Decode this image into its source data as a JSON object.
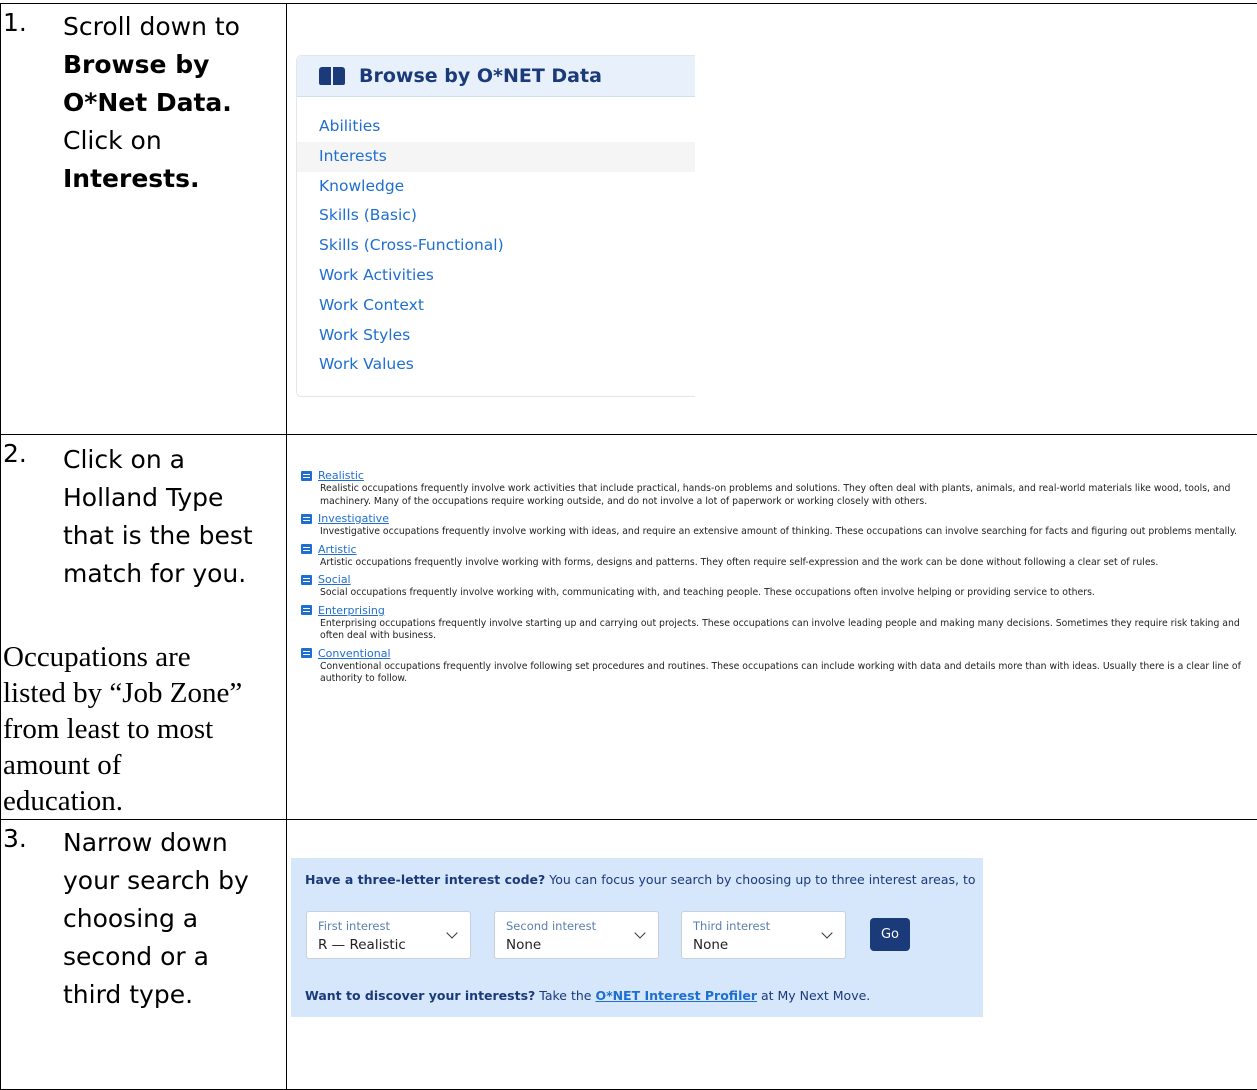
{
  "steps": [
    {
      "num": "1.",
      "line1": "Scroll down to",
      "bold1": "Browse by",
      "bold2": "O*Net Data.",
      "line2": "Click on",
      "bold3": "Interests."
    },
    {
      "num": "2.",
      "lines": [
        "Click on a",
        "Holland Type",
        "that is the best",
        "match for you."
      ]
    },
    {
      "num": "3.",
      "lines": [
        "Narrow down",
        "your search by",
        "choosing a",
        "second or a",
        "third type."
      ]
    }
  ],
  "note": [
    "Occupations are",
    "listed by “Job Zone”",
    "from least to most",
    "amount of",
    "education."
  ],
  "browse": {
    "title": "Browse by O*NET Data",
    "items": [
      "Abilities",
      "Interests",
      "Knowledge",
      "Skills (Basic)",
      "Skills (Cross-Functional)",
      "Work Activities",
      "Work Context",
      "Work Styles",
      "Work Values"
    ]
  },
  "types": [
    {
      "name": "Realistic",
      "desc": "Realistic occupations frequently involve work activities that include practical, hands-on problems and solutions. They often deal with plants, animals, and real-world materials like wood, tools, and machinery. Many of the occupations require working outside, and do not involve a lot of paperwork or working closely with others."
    },
    {
      "name": "Investigative",
      "desc": "Investigative occupations frequently involve working with ideas, and require an extensive amount of thinking. These occupations can involve searching for facts and figuring out problems mentally."
    },
    {
      "name": "Artistic",
      "desc": "Artistic occupations frequently involve working with forms, designs and patterns. They often require self-expression and the work can be done without following a clear set of rules."
    },
    {
      "name": "Social",
      "desc": "Social occupations frequently involve working with, communicating with, and teaching people. These occupations often involve helping or providing service to others."
    },
    {
      "name": "Enterprising",
      "desc": "Enterprising occupations frequently involve starting up and carrying out projects. These occupations can involve leading people and making many decisions. Sometimes they require risk taking and often deal with business."
    },
    {
      "name": "Conventional",
      "desc": "Conventional occupations frequently involve following set procedures and routines. These occupations can include working with data and details more than with ideas. Usually there is a clear line of authority to follow."
    }
  ],
  "interest": {
    "head_bold": "Have a three-letter interest code?",
    "head_rest": " You can focus your search by choosing up to three interest areas, to",
    "selects": [
      {
        "label": "First interest",
        "value": "R — Realistic"
      },
      {
        "label": "Second interest",
        "value": "None"
      },
      {
        "label": "Third interest",
        "value": "None"
      }
    ],
    "go": "Go",
    "foot_bold": "Want to discover your interests?",
    "foot_mid": " Take the ",
    "foot_link": "O*NET Interest Profiler",
    "foot_end": " at My Next Move."
  }
}
